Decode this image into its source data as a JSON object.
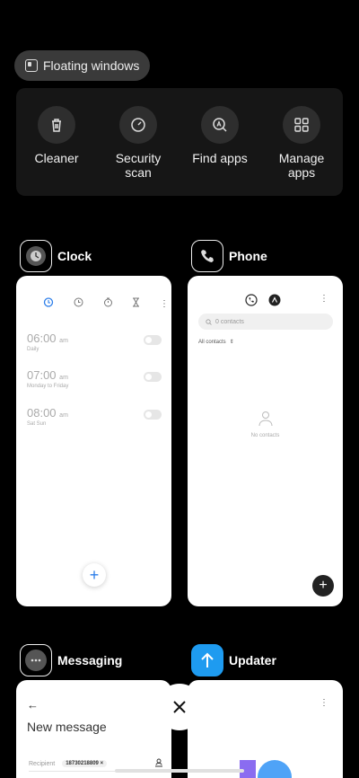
{
  "floating_windows_label": "Floating windows",
  "tools": [
    {
      "label": "Cleaner",
      "icon": "trash-icon"
    },
    {
      "label": "Security\nscan",
      "icon": "speedometer-icon"
    },
    {
      "label": "Find apps",
      "icon": "search-a-icon"
    },
    {
      "label": "Manage\napps",
      "icon": "grid-icon"
    }
  ],
  "apps": {
    "clock": {
      "name": "Clock"
    },
    "phone": {
      "name": "Phone"
    },
    "messaging": {
      "name": "Messaging"
    },
    "updater": {
      "name": "Updater"
    }
  },
  "clock_card": {
    "alarms": [
      {
        "time": "06:00",
        "ampm": "am",
        "sub": "Daily"
      },
      {
        "time": "07:00",
        "ampm": "am",
        "sub": "Monday to Friday"
      },
      {
        "time": "08:00",
        "ampm": "am",
        "sub": "Sat Sun"
      }
    ]
  },
  "phone_card": {
    "search_placeholder": "0 contacts",
    "filter_label": "All contacts",
    "empty_label": "No contacts"
  },
  "messaging_card": {
    "title": "New message",
    "recipient_label": "Recipient",
    "recipient_chip": "18730218809"
  },
  "colors": {
    "accent": "#2b7de9",
    "updater_icon": "#1e9bf0"
  }
}
